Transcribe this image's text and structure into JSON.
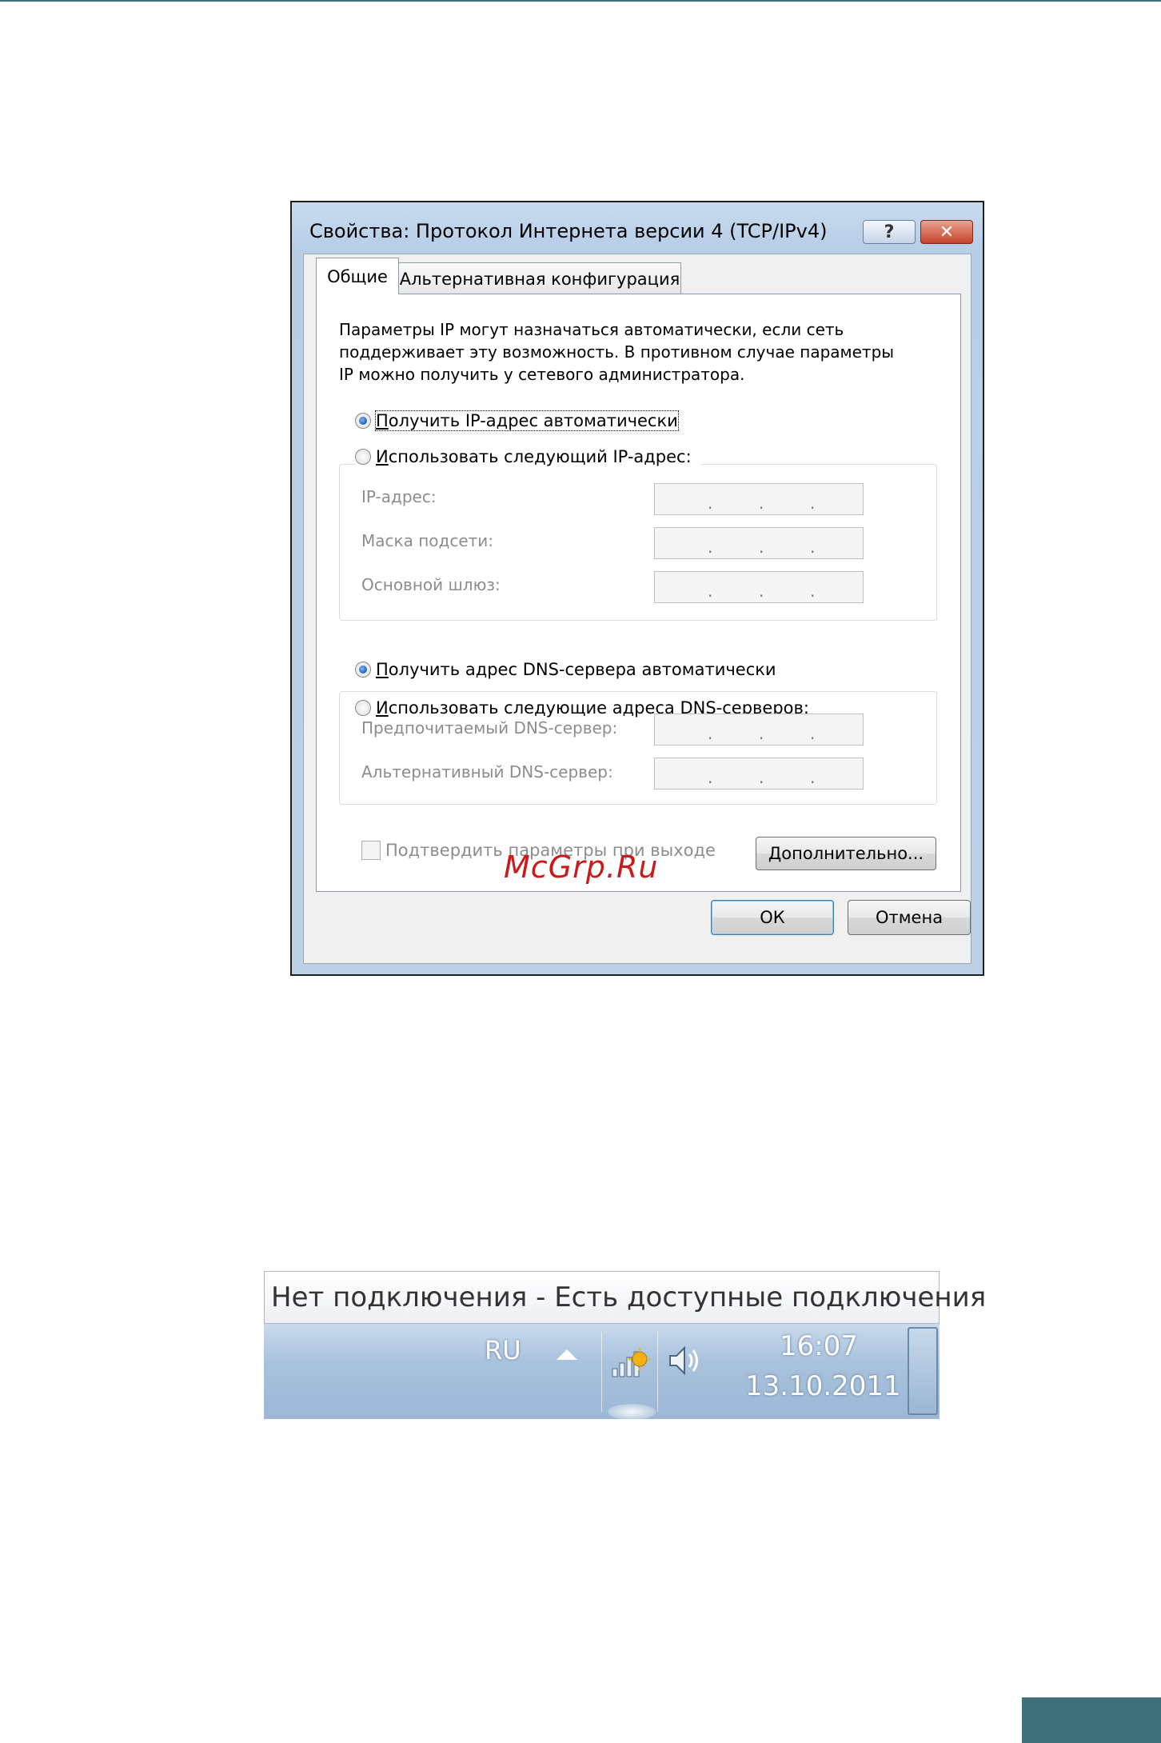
{
  "dialog": {
    "title": "Свойства: Протокол Интернета версии 4 (TCP/IPv4)",
    "help_label": "?",
    "close_label": "✕",
    "tabs": [
      {
        "label": "Общие"
      },
      {
        "label": "Альтернативная конфигурация"
      }
    ],
    "description": [
      "Параметры IP могут назначаться автоматически, если сеть",
      "поддерживает эту возможность. В противном случае параметры",
      "IP можно получить у сетевого администратора."
    ],
    "ip": {
      "auto_label": "Получить IP-адрес автоматически",
      "manual_label": "Использовать следующий IP-адрес:",
      "auto_selected": true,
      "fields": [
        {
          "label": "IP-адрес:"
        },
        {
          "label": "Маска подсети:"
        },
        {
          "label": "Основной шлюз:"
        }
      ]
    },
    "dns": {
      "auto_label": "Получить адрес DNS-сервера автоматически",
      "manual_label": "Использовать следующие адреса DNS-серверов:",
      "auto_selected": true,
      "fields": [
        {
          "label": "Предпочитаемый DNS-сервер:"
        },
        {
          "label": "Альтернативный DNS-сервер:"
        }
      ]
    },
    "validate_label": "Подтвердить параметры при выходе",
    "advanced_label": "Дополнительно...",
    "ok_label": "ОК",
    "cancel_label": "Отмена"
  },
  "watermark": "McGrp.Ru",
  "taskbar": {
    "tooltip": "Нет подключения - Есть доступные подключения",
    "language": "RU",
    "time": "16:07",
    "date": "13.10.2011",
    "icons": [
      "show-hidden-icons-arrow",
      "network-no-connection-icon",
      "speaker-volume-icon"
    ]
  },
  "colors": {
    "accent": "#3f6f78",
    "watermark": "#cc1a1a",
    "taskbar": "#a9c2dd"
  }
}
